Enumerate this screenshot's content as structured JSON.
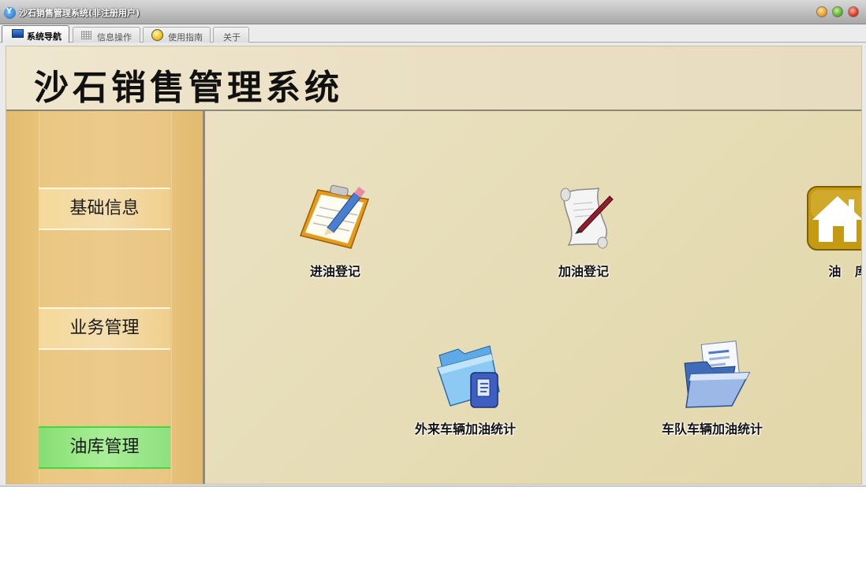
{
  "window": {
    "title": "沙石销售管理系统(非注册用户)",
    "controls": [
      "minimize",
      "maximize",
      "close"
    ]
  },
  "tabs": [
    {
      "label": "系统导航",
      "icon": "monitor-icon",
      "active": true
    },
    {
      "label": "信息操作",
      "icon": "grid-icon",
      "active": false
    },
    {
      "label": "使用指南",
      "icon": "help-icon",
      "active": false
    },
    {
      "label": "关于",
      "icon": "",
      "active": false
    }
  ],
  "header": {
    "title": "沙石销售管理系统"
  },
  "sidebar": {
    "items": [
      {
        "label": "基础信息",
        "active": false
      },
      {
        "label": "业务管理",
        "active": false
      },
      {
        "label": "油库管理",
        "active": true
      }
    ]
  },
  "main": {
    "items": [
      {
        "label": "进油登记",
        "icon": "clipboard-pencil-icon"
      },
      {
        "label": "加油登记",
        "icon": "scroll-pen-icon"
      },
      {
        "label": "油 库 存",
        "icon": "house-icon"
      },
      {
        "label": "外来车辆加油统计",
        "icon": "blue-folder-icon"
      },
      {
        "label": "车队车辆加油统计",
        "icon": "document-folder-icon"
      }
    ]
  },
  "colors": {
    "sidebar": "#e8c27b",
    "active_nav": "#9ee58a",
    "content_bg": "#e6dcb0"
  }
}
